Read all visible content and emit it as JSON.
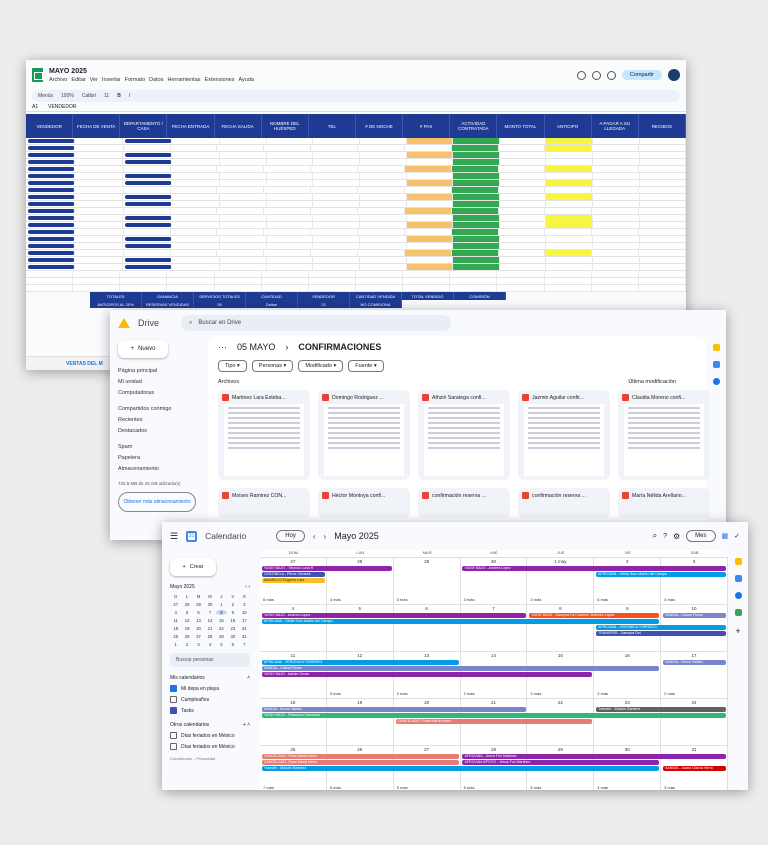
{
  "sheets": {
    "title": "MAYO 2025",
    "menus": [
      "Archivo",
      "Editar",
      "Ver",
      "Insertar",
      "Formato",
      "Datos",
      "Herramientas",
      "Extensiones",
      "Ayuda"
    ],
    "share_label": "Compartir",
    "toolbar": {
      "search": "Menús",
      "zoom": "100%",
      "font": "Calibri",
      "size": "11"
    },
    "cell_ref": "A1",
    "formula": "VENDEDOR",
    "headers": [
      "VENDEDOR",
      "FECHA DE VENTA",
      "DEPARTAMENTO / CASA",
      "FECHA ENTRADA",
      "FECHA SALIDA",
      "NOMBRE DEL HUÉSPED",
      "TEL",
      "# DE NOCHE",
      "# PAX",
      "ACTIVIDAD CONTRATADA",
      "MONTO TOTAL",
      "ANTICIPO",
      "A PAGAR A SU LLEGADA",
      "RECIBOS"
    ],
    "totals": [
      "TOTALES",
      "GANANCIA",
      "SERVICIOS TOTALES",
      "CANTIDAD",
      "VENDEDOR",
      "CANTIDAD VENDIDA",
      "TOTAL VENDIDO",
      "COMISIÓN"
    ],
    "totals_row": [
      "ANTICIPOS AL 20%",
      "RESERVAS VENDIDAS",
      "39",
      "Dalton",
      "22",
      "NO COMISIONA"
    ],
    "tab_label": "VENTAS DEL M"
  },
  "drive": {
    "app_name": "Drive",
    "search_placeholder": "Buscar en Drive",
    "new_label": "Nuevo",
    "nav": [
      "Página principal",
      "Mi unidad",
      "Computadoras",
      "Compartidos conmigo",
      "Recientes",
      "Destacados",
      "Spam",
      "Papelera",
      "Almacenamiento"
    ],
    "storage": "732.9 MB de 15 GB utilizado(s)",
    "get_more": "Obtener más almacenamiento",
    "breadcrumb": [
      "05 MAYO",
      "CONFIRMACIONES"
    ],
    "filters": [
      "Tipo",
      "Personas",
      "Modificado",
      "Fuente"
    ],
    "section": "Archivos",
    "sort": "Última modificación",
    "files_row1": [
      "Martinez Lara Esteba...",
      "Domingo Rodriguez ...",
      "Athziri Saratega confi...",
      "Jazmin Aguilar confir...",
      "Claudia Moreno confi..."
    ],
    "files_row2": [
      "Moises Ramirez CON...",
      "Héctor Montoya confi...",
      "confirmación reserva ...",
      "confirmación reserva ...",
      "María Nélida Arellano..."
    ]
  },
  "calendar": {
    "app_name": "Calendario",
    "today": "Hoy",
    "month": "Mayo 2025",
    "view": "Mes",
    "create": "Crear",
    "mini_month": "Mayo 2025",
    "mini_days": [
      "D",
      "L",
      "M",
      "M",
      "J",
      "V",
      "S"
    ],
    "mini_dates": [
      "27",
      "28",
      "29",
      "30",
      "1",
      "2",
      "3",
      "4",
      "5",
      "6",
      "7",
      "8",
      "9",
      "10",
      "11",
      "12",
      "13",
      "14",
      "15",
      "16",
      "17",
      "18",
      "19",
      "20",
      "21",
      "22",
      "23",
      "24",
      "25",
      "26",
      "27",
      "28",
      "29",
      "30",
      "31",
      "1",
      "2",
      "3",
      "4",
      "5",
      "6",
      "7"
    ],
    "search_people": "Buscar personas",
    "my_calendars": "Mis calendarios",
    "cal_items": [
      "Mi depa en playa",
      "Cumpleaños",
      "Tasks"
    ],
    "other_calendars": "Otros calendarios",
    "other_items": [
      "Días feriados en México",
      "Días feriados en México"
    ],
    "footer": "Condiciones – Privacidad",
    "weekdays": [
      "DOM",
      "LUN",
      "MAR",
      "MIÉ",
      "JUE",
      "VIE",
      "SÁB"
    ],
    "weeks": [
      {
        "dates": [
          "27",
          "28",
          "29",
          "30",
          "1 may",
          "2",
          "3"
        ],
        "more": [
          "6 más",
          "4 más",
          "3 más",
          "3 más",
          "3 más",
          "6 más",
          "4 más"
        ]
      },
      {
        "dates": [
          "4",
          "5",
          "6",
          "7",
          "8",
          "9",
          "10"
        ],
        "more": [
          "",
          "",
          "",
          "",
          "",
          "",
          ""
        ]
      },
      {
        "dates": [
          "11",
          "12",
          "13",
          "14",
          "15",
          "16",
          "17"
        ],
        "more": [
          "",
          "3 más",
          "2 más",
          "2 más",
          "3 más",
          "2 más",
          "2 más"
        ]
      },
      {
        "dates": [
          "18",
          "19",
          "20",
          "21",
          "22",
          "23",
          "24"
        ],
        "more": [
          "",
          "",
          "",
          "",
          "",
          "",
          ""
        ]
      },
      {
        "dates": [
          "25",
          "26",
          "27",
          "28",
          "29",
          "30",
          "31"
        ],
        "more": [
          "7 más",
          "5 más",
          "5 más",
          "5 más",
          "5 más",
          "4 más",
          "3 más"
        ]
      }
    ],
    "events": [
      {
        "w": 0,
        "c": 0,
        "span": 2,
        "row": 0,
        "label": "YATAY BAJO - Tiburcio Luna R",
        "color": "c-purple"
      },
      {
        "w": 0,
        "c": 3,
        "span": 4,
        "row": 0,
        "label": "YATAY BAJO - Andrea López",
        "color": "c-purple"
      },
      {
        "w": 0,
        "c": 0,
        "span": 1,
        "row": 1,
        "label": "CENTINELA - Pérez Olivares",
        "color": "c-navy"
      },
      {
        "w": 0,
        "c": 5,
        "span": 2,
        "row": 1,
        "label": "AFRICANA - Ofelia Suro Martín del Campo",
        "color": "c-blue"
      },
      {
        "w": 0,
        "c": 0,
        "span": 1,
        "row": 2,
        "label": "AMARILLO Eugenio Lara",
        "color": "c-yellow"
      },
      {
        "w": 1,
        "c": 0,
        "span": 4,
        "row": 0,
        "label": "YATAY BAJO - Andrea López",
        "color": "c-purple"
      },
      {
        "w": 1,
        "c": 4,
        "span": 2,
        "row": 0,
        "label": "YATAY BAJO - Daneyra Del Carmen Jimenez López",
        "color": "c-orange"
      },
      {
        "w": 1,
        "c": 6,
        "span": 1,
        "row": 0,
        "label": "SANDIA - Liliana Flores",
        "color": "c-lav"
      },
      {
        "w": 1,
        "c": 0,
        "span": 6,
        "row": 1,
        "label": "AFRICANA - Ofelia Suro Martín del Campo",
        "color": "c-blue"
      },
      {
        "w": 1,
        "c": 5,
        "span": 2,
        "row": 2,
        "label": "AFRICANA - VERONICA TORRERO",
        "color": "c-blue"
      },
      {
        "w": 1,
        "c": 5,
        "span": 2,
        "row": 3,
        "label": "TRANSFER - Daneyra Del",
        "color": "c-navy"
      },
      {
        "w": 2,
        "c": 0,
        "span": 3,
        "row": 0,
        "label": "AFRICANA - VERONICA TORRERO",
        "color": "c-blue"
      },
      {
        "w": 2,
        "c": 6,
        "span": 1,
        "row": 0,
        "label": "SANDIA - Bruno Valdés",
        "color": "c-lav"
      },
      {
        "w": 2,
        "c": 0,
        "span": 6,
        "row": 1,
        "label": "SANDIA - Liliana Flores",
        "color": "c-lav"
      },
      {
        "w": 2,
        "c": 0,
        "span": 5,
        "row": 2,
        "label": "YATAY BAJO - Adrian Orcas",
        "color": "c-purple"
      },
      {
        "w": 3,
        "c": 0,
        "span": 4,
        "row": 0,
        "label": "SANDIA - Bruno Valdés",
        "color": "c-lav"
      },
      {
        "w": 3,
        "c": 5,
        "span": 2,
        "row": 0,
        "label": "Transfer - Moises Ramirez",
        "color": "c-dark"
      },
      {
        "w": 3,
        "c": 0,
        "span": 7,
        "row": 1,
        "label": "YATAY BAJO - Francisco Camacho",
        "color": "c-green"
      },
      {
        "w": 3,
        "c": 2,
        "span": 3,
        "row": 2,
        "label": "CANCELADO- Rosa María torres",
        "color": "c-salmon"
      },
      {
        "w": 4,
        "c": 0,
        "span": 3,
        "row": 0,
        "label": "CANCELADO- Rosa María torres",
        "color": "c-salmon"
      },
      {
        "w": 4,
        "c": 3,
        "span": 4,
        "row": 0,
        "label": "AFRICANA - Jesus Fox Martinez",
        "color": "c-purple"
      },
      {
        "w": 4,
        "c": 0,
        "span": 3,
        "row": 1,
        "label": "CANCELADO- Rosa María torres",
        "color": "c-salmon"
      },
      {
        "w": 4,
        "c": 3,
        "span": 3,
        "row": 1,
        "label": "AFRICANA APOYO - Jesus Fox Martinez",
        "color": "c-purple"
      },
      {
        "w": 4,
        "c": 0,
        "span": 6,
        "row": 2,
        "label": "Transfer - Moises Ramirez",
        "color": "c-blue"
      },
      {
        "w": 4,
        "c": 6,
        "span": 1,
        "row": 2,
        "label": "SANDIA - Juana García Herm",
        "color": "c-red"
      }
    ]
  }
}
